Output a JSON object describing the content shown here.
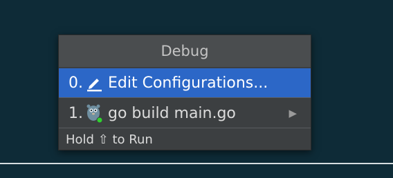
{
  "popup": {
    "title": "Debug",
    "items": [
      {
        "number": "0.",
        "icon": "pencil-icon",
        "label": "Edit Configurations...",
        "selected": true
      },
      {
        "number": "1.",
        "icon": "gopher-icon",
        "label": "go build main.go",
        "has_submenu": true,
        "submenu_arrow": "▶"
      }
    ],
    "footer": "Hold ⇧ to Run"
  },
  "colors": {
    "background": "#0e2b37",
    "popup_bg": "#3c3f41",
    "header_bg": "#4a4d4f",
    "selection": "#2c67c7",
    "run_indicator": "#2fd12f"
  }
}
